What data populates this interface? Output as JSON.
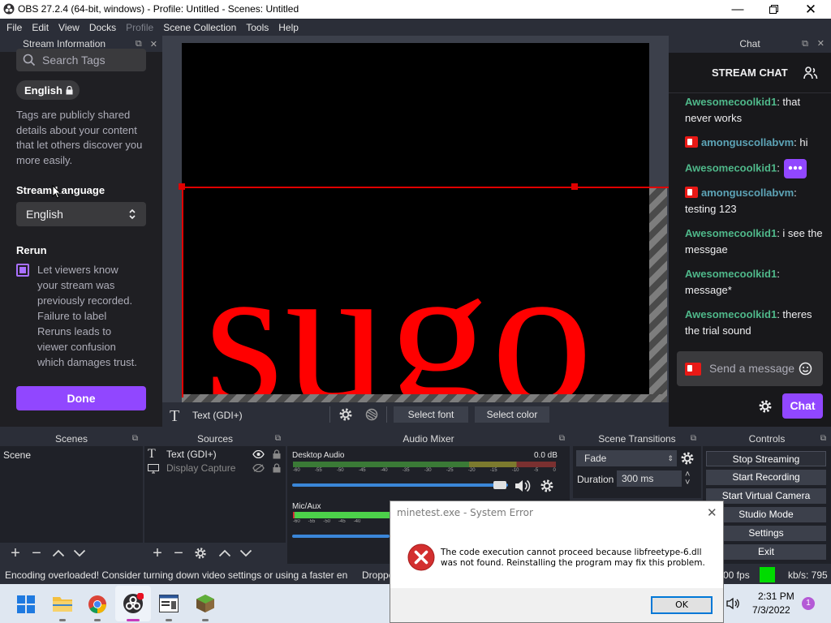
{
  "window": {
    "title": "OBS 27.2.4 (64-bit, windows) - Profile: Untitled - Scenes: Untitled"
  },
  "menu": [
    "File",
    "Edit",
    "View",
    "Docks",
    "Profile",
    "Scene Collection",
    "Tools",
    "Help"
  ],
  "stream_info": {
    "dock_title": "Stream Information",
    "search_placeholder": "Search Tags",
    "tag": "English",
    "tags_description": [
      "Tags are publicly shared",
      "details about your content",
      "that let others discover you",
      "more easily."
    ],
    "language_label": "Stream Language",
    "language_value": "English",
    "rerun_label": "Rerun",
    "rerun_description": [
      "Let viewers know",
      "your stream was",
      "previously recorded.",
      "Failure to label",
      "Reruns leads to",
      "viewer confusion",
      "which damages trust."
    ],
    "done_label": "Done"
  },
  "preview": {
    "text": "sugo"
  },
  "context_bar": {
    "source_name": "Text (GDI+)",
    "select_font": "Select font",
    "select_color": "Select color"
  },
  "chat": {
    "dock_title": "Chat",
    "header": "STREAM CHAT",
    "messages": [
      {
        "user": "Awesomecoolkid1",
        "text": ": that never works"
      },
      {
        "user": "amonguscollabvm",
        "text": ": hi"
      },
      {
        "user": "Awesomecoolkid1",
        "text": ":"
      },
      {
        "user": "amonguscollabvm",
        "text": ": testing 123"
      },
      {
        "user": "Awesomecoolkid1",
        "text": ": i see the messgae"
      },
      {
        "user": "Awesomecoolkid1",
        "text": ": message*"
      },
      {
        "user": "Awesomecoolkid1",
        "text": ": theres the trial sound"
      }
    ],
    "input_placeholder": "Send a message",
    "send_label": "Chat"
  },
  "scenes": {
    "title": "Scenes",
    "items": [
      "Scene"
    ]
  },
  "sources": {
    "title": "Sources",
    "items": [
      "Text (GDI+)",
      "Display Capture"
    ]
  },
  "audio_mixer": {
    "title": "Audio Mixer",
    "channels": [
      {
        "name": "Desktop Audio",
        "db": "0.0 dB"
      },
      {
        "name": "Mic/Aux",
        "db": ""
      }
    ],
    "scale": [
      "-60",
      "-55",
      "-50",
      "-45",
      "-40",
      "-35",
      "-30",
      "-25",
      "-20",
      "-15",
      "-10",
      "-5",
      "0"
    ]
  },
  "transitions": {
    "title": "Scene Transitions",
    "transition": "Fade",
    "duration_label": "Duration",
    "duration_value": "300 ms"
  },
  "controls": {
    "title": "Controls",
    "buttons": [
      "Stop Streaming",
      "Start Recording",
      "Start Virtual Camera",
      "Studio Mode",
      "Settings",
      "Exit"
    ]
  },
  "status": {
    "message": "Encoding overloaded! Consider turning down video settings or using a faster en",
    "dropped": "Droppe",
    "fps": "00 fps",
    "kbps": "kb/s: 795"
  },
  "taskbar": {
    "time": "2:31 PM",
    "date": "7/3/2022",
    "notifications": "1"
  },
  "dialog": {
    "title": "minetest.exe - System Error",
    "message_line1": "The code execution cannot proceed because libfreetype-6.dll",
    "message_line2": "was not found. Reinstalling the program may fix this problem.",
    "ok_label": "OK"
  },
  "colors": {
    "accent": "#9147ff",
    "obs_bg": "#2b2e38",
    "twitch_dark": "#18181b",
    "error_red": "#c42b1c",
    "preview_red": "#ff0000"
  }
}
